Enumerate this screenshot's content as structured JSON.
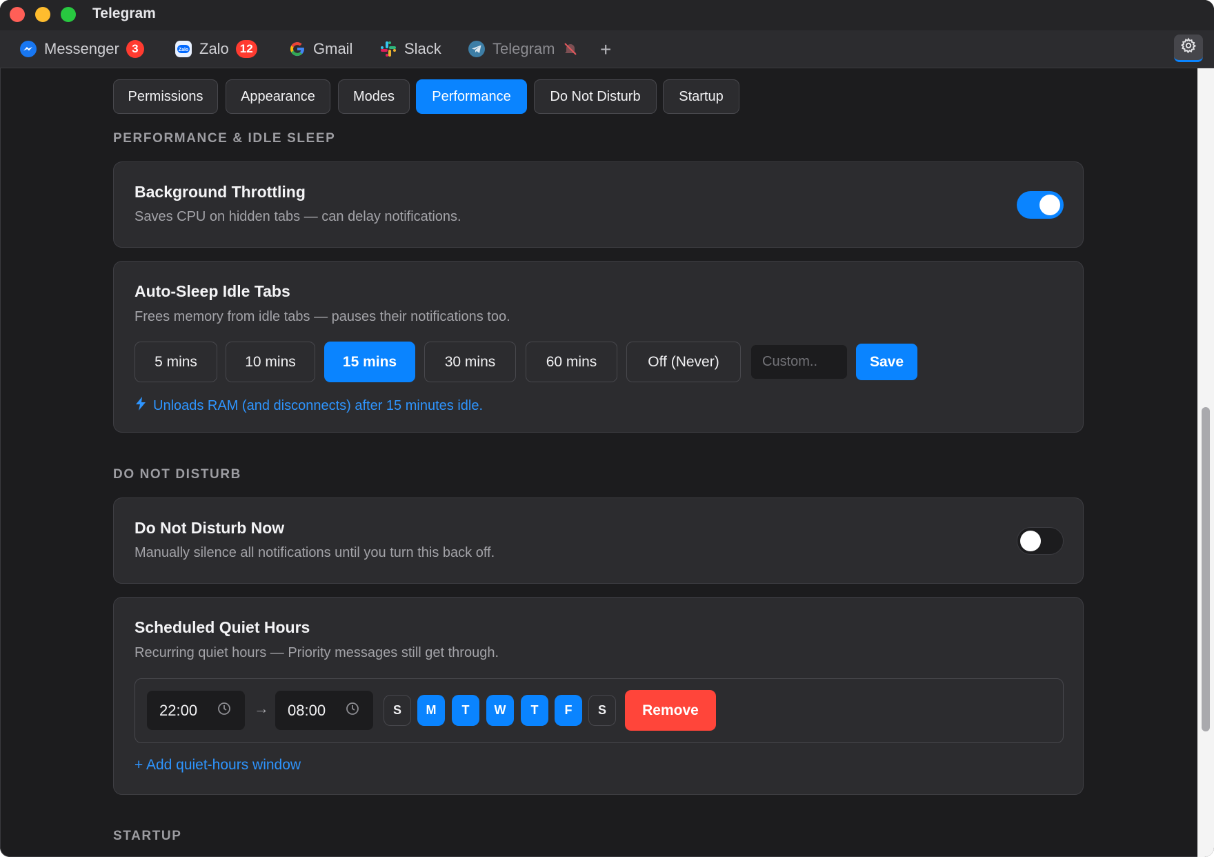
{
  "window": {
    "title": "Telegram"
  },
  "app_tabs": [
    {
      "label": "Messenger",
      "badge": "3",
      "icon": "messenger-icon"
    },
    {
      "label": "Zalo",
      "badge": "12",
      "icon": "zalo-icon"
    },
    {
      "label": "Gmail",
      "badge": "",
      "icon": "gmail-icon"
    },
    {
      "label": "Slack",
      "badge": "",
      "icon": "slack-icon"
    },
    {
      "label": "Telegram",
      "badge": "",
      "icon": "telegram-icon",
      "muted": true
    }
  ],
  "add_tab_label": "+",
  "settings_tabs": [
    "Permissions",
    "Appearance",
    "Modes",
    "Performance",
    "Do Not Disturb",
    "Startup"
  ],
  "active_settings_tab": "Performance",
  "performance": {
    "heading": "PERFORMANCE & IDLE SLEEP",
    "throttling": {
      "title": "Background Throttling",
      "desc": "Saves CPU on hidden tabs — can delay notifications.",
      "enabled": true
    },
    "autosleep": {
      "title": "Auto-Sleep Idle Tabs",
      "desc": "Frees memory from idle tabs — pauses their notifications too.",
      "options": [
        "5 mins",
        "10 mins",
        "15 mins",
        "30 mins",
        "60 mins",
        "Off (Never)"
      ],
      "selected": "15 mins",
      "custom_placeholder": "Custom..",
      "save_label": "Save",
      "note": "Unloads RAM (and disconnects) after 15 minutes idle."
    }
  },
  "dnd": {
    "heading": "DO NOT DISTURB",
    "now": {
      "title": "Do Not Disturb Now",
      "desc": "Manually silence all notifications until you turn this back off.",
      "enabled": false
    },
    "schedule": {
      "title": "Scheduled Quiet Hours",
      "desc": "Recurring quiet hours — Priority messages still get through.",
      "start": "22:00",
      "end": "08:00",
      "arrow": "→",
      "days": [
        {
          "label": "S",
          "on": false
        },
        {
          "label": "M",
          "on": true
        },
        {
          "label": "T",
          "on": true
        },
        {
          "label": "W",
          "on": true
        },
        {
          "label": "T",
          "on": true
        },
        {
          "label": "F",
          "on": true
        },
        {
          "label": "S",
          "on": false
        }
      ],
      "remove_label": "Remove",
      "add_label": "+ Add quiet-hours window"
    }
  },
  "startup": {
    "heading": "STARTUP"
  },
  "colors": {
    "accent": "#0a84ff",
    "danger": "#ff453a",
    "badge": "#ff3b30",
    "bg": "#1c1c1e",
    "card": "#2c2c2f"
  }
}
